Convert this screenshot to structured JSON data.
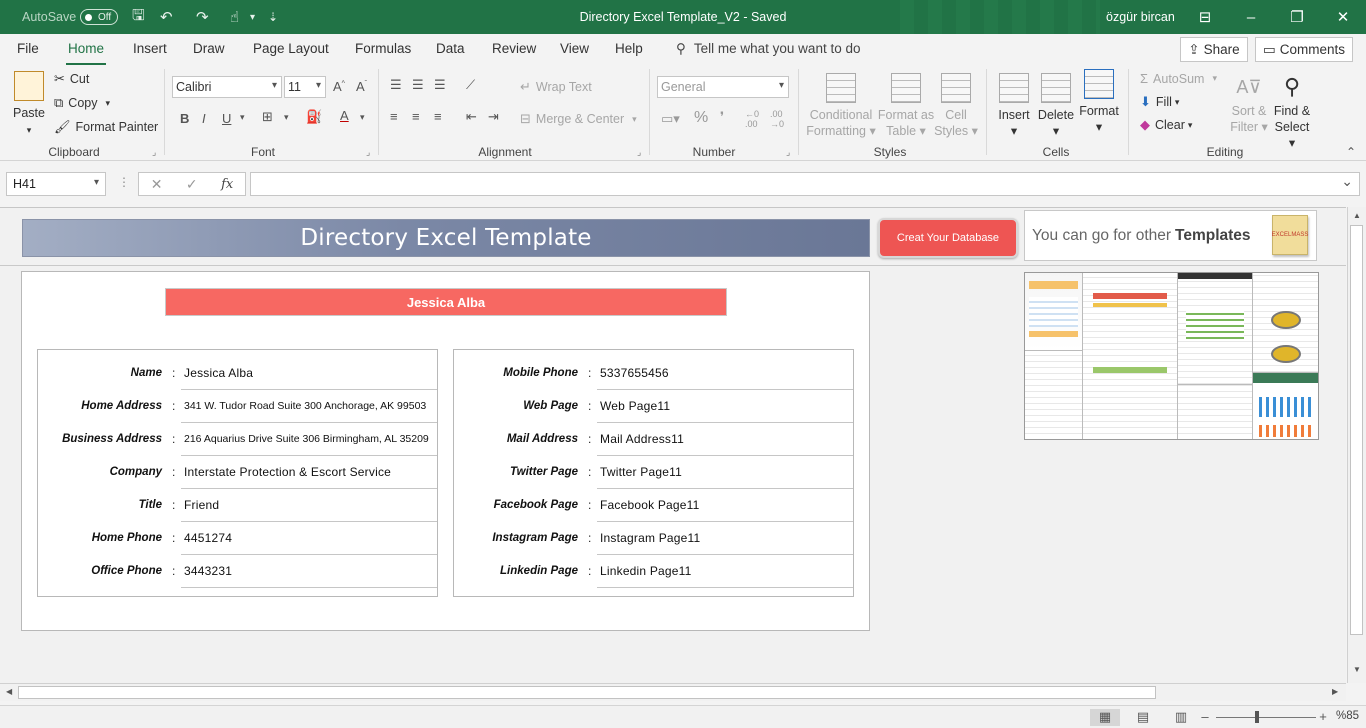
{
  "titlebar": {
    "autosave_label": "AutoSave",
    "autosave_state": "Off",
    "title": "Directory Excel Template_V2  -  Saved",
    "user": "özgür bircan"
  },
  "tabs": [
    "File",
    "Home",
    "Insert",
    "Draw",
    "Page Layout",
    "Formulas",
    "Data",
    "Review",
    "View",
    "Help"
  ],
  "active_tab": "Home",
  "tell_me": "Tell me what you want to do",
  "share_label": "Share",
  "comments_label": "Comments",
  "ribbon": {
    "clipboard": {
      "paste": "Paste",
      "cut": "Cut",
      "copy": "Copy",
      "format_painter": "Format Painter",
      "label": "Clipboard"
    },
    "font": {
      "name": "Calibri",
      "size": "11",
      "label": "Font"
    },
    "alignment": {
      "wrap_text": "Wrap Text",
      "merge_center": "Merge & Center",
      "label": "Alignment"
    },
    "number": {
      "format": "General",
      "label": "Number"
    },
    "styles": {
      "conditional": "Conditional",
      "formatting": "Formatting",
      "format_as": "Format as",
      "table": "Table",
      "cell": "Cell",
      "cell_styles": "Styles",
      "label": "Styles"
    },
    "cells": {
      "insert": "Insert",
      "delete": "Delete",
      "format": "Format",
      "label": "Cells"
    },
    "editing": {
      "autosum": "AutoSum",
      "fill": "Fill",
      "clear": "Clear",
      "sort": "Sort &",
      "filter": "Filter",
      "find": "Find &",
      "select": "Select",
      "label": "Editing"
    }
  },
  "formula_bar": {
    "name_box": "H41",
    "fx": "fx",
    "value": ""
  },
  "sheet": {
    "banner_title": "Directory Excel Template",
    "db_button": "Creat Your Database",
    "templates_text": "You can go for other",
    "templates_bold": "Templates",
    "logo_text": "EXCELMASS",
    "contact_name": "Jessica Alba",
    "left_fields": [
      {
        "label": "Name",
        "value": "Jessica Alba"
      },
      {
        "label": "Home Address",
        "value": "341 W. Tudor Road Suite 300 Anchorage, AK 99503"
      },
      {
        "label": "Business Address",
        "value": "216 Aquarius Drive Suite 306 Birmingham, AL 35209"
      },
      {
        "label": "Company",
        "value": "Interstate Protection & Escort Service"
      },
      {
        "label": "Title",
        "value": "Friend"
      },
      {
        "label": "Home Phone",
        "value": "4451274"
      },
      {
        "label": "Office Phone",
        "value": "3443231"
      }
    ],
    "right_fields": [
      {
        "label": "Mobile Phone",
        "value": "5337655456"
      },
      {
        "label": "Web Page",
        "value": "Web Page11"
      },
      {
        "label": "Mail Address",
        "value": "Mail Address11"
      },
      {
        "label": "Twitter Page",
        "value": "Twitter Page11"
      },
      {
        "label": "Facebook Page",
        "value": "Facebook Page11"
      },
      {
        "label": "Instagram Page",
        "value": "Instagram Page11"
      },
      {
        "label": "Linkedin Page",
        "value": "Linkedin Page11"
      }
    ]
  },
  "status": {
    "zoom": "%85"
  },
  "colors": {
    "accent": "#217346",
    "name_bar": "#f76862",
    "db_button": "#ee5553",
    "banner": "#7b88a6"
  }
}
